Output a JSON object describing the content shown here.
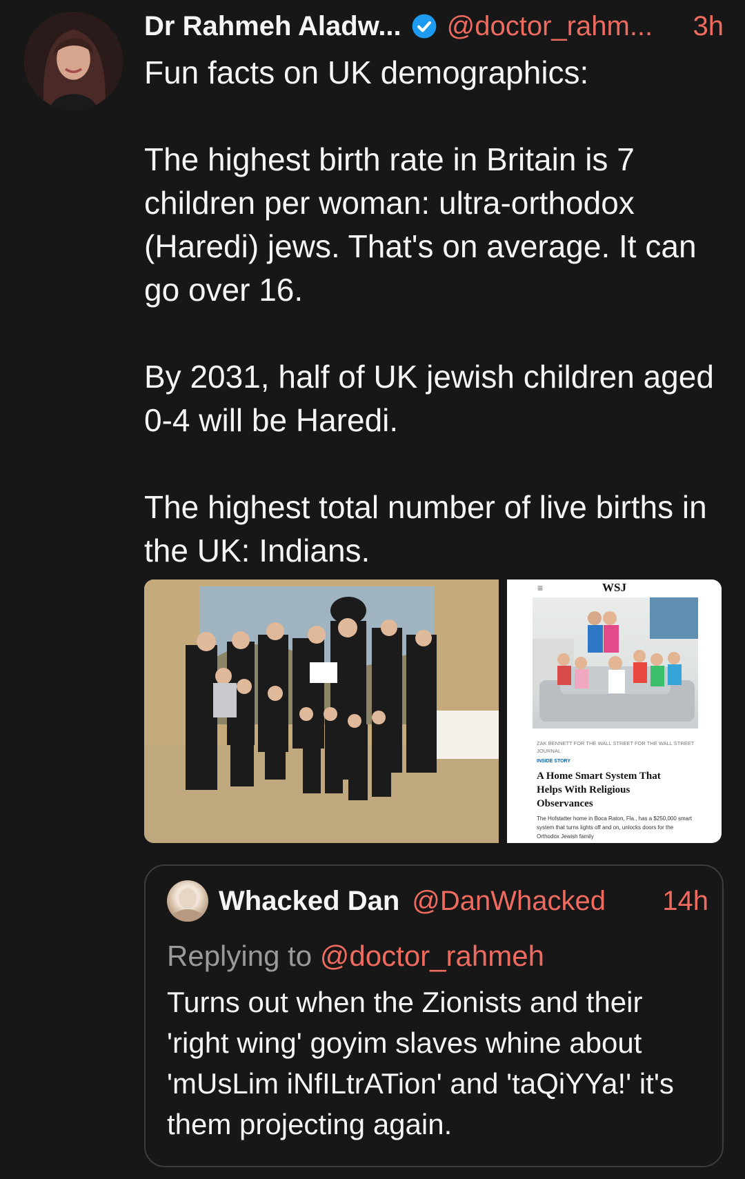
{
  "tweet": {
    "author_name": "Dr Rahmeh Aladw...",
    "handle": "@doctor_rahm...",
    "time": "3h",
    "paragraphs": [
      "Fun facts on UK demographics:",
      "The highest birth rate in Britain is 7 children per woman: ultra-orthodox (Haredi) jews. That's on average. It can go over 16.",
      "By 2031, half of UK jewish children aged 0-4 will be Haredi.",
      "The highest total number of live births in the UK: Indians."
    ]
  },
  "media": {
    "wsj": {
      "menu": "≡",
      "logo": "WSJ",
      "credit": "ZAK BENNETT FOR THE WALL STREET FOR THE WALL STREET JOURNAL",
      "kicker": "INSIDE STORY",
      "headline": "A Home Smart System That Helps With Religious Observances",
      "dek": "The Hofstatter home in Boca Raton, Fla., has a $250,000 smart system that turns lights off and on, unlocks doors for the Orthodox Jewish family"
    }
  },
  "quote": {
    "author_name": "Whacked Dan",
    "handle": "@DanWhacked",
    "time": "14h",
    "replying_prefix": "Replying to",
    "replying_mention": "@doctor_rahmeh",
    "text": "Turns out when the Zionists and their 'right wing' goyim slaves whine about 'mUsLim iNfILtrATion' and 'taQiYYa!' it's them projecting again."
  },
  "colors": {
    "background": "#171717",
    "accent": "#ef6b5f",
    "verified": "#1d9bf0",
    "muted": "#9a9a9a"
  }
}
